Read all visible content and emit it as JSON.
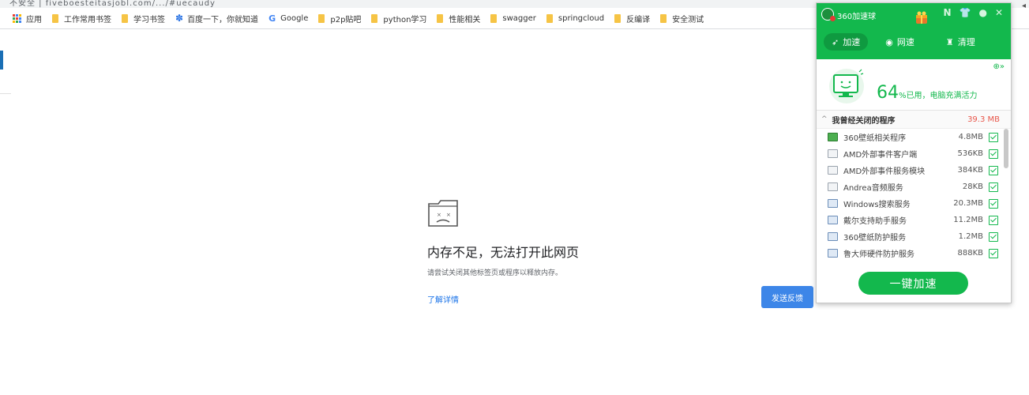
{
  "browser": {
    "address_fragment": "不安全 | fiveboesteitasjobl.com/.../#uecaudy",
    "bookmarks": [
      {
        "label": "应用",
        "icon": "apps-grid-icon"
      },
      {
        "label": "工作常用书签",
        "icon": "folder-icon"
      },
      {
        "label": "学习书签",
        "icon": "folder-icon"
      },
      {
        "label": "百度一下，你就知道",
        "icon": "baidu-paw-icon"
      },
      {
        "label": "Google",
        "icon": "google-g-icon"
      },
      {
        "label": "p2p贴吧",
        "icon": "folder-icon"
      },
      {
        "label": "python学习",
        "icon": "folder-icon"
      },
      {
        "label": "性能相关",
        "icon": "folder-icon"
      },
      {
        "label": "swagger",
        "icon": "folder-icon"
      },
      {
        "label": "springcloud",
        "icon": "folder-icon"
      },
      {
        "label": "反编译",
        "icon": "folder-icon"
      },
      {
        "label": "安全测试",
        "icon": "folder-icon"
      }
    ],
    "colors": {
      "folder": "#f6c445",
      "link": "#1a73e8",
      "button": "#3d86e8"
    }
  },
  "error_page": {
    "icon": "sad-tab-icon",
    "title": "内存不足，无法打开此网页",
    "description": "请尝试关闭其他标签页或程序以释放内存。",
    "learn_more": "了解详情",
    "feedback_button": "发送反馈"
  },
  "accelerator": {
    "title": "360加速球",
    "header_icons": [
      "N",
      "shirt-icon",
      "chat-icon",
      "close-icon"
    ],
    "tabs": [
      {
        "label": "加速",
        "icon": "rocket-icon",
        "active": true
      },
      {
        "label": "网速",
        "icon": "network-icon",
        "active": false
      },
      {
        "label": "清理",
        "icon": "broom-icon",
        "active": false
      }
    ],
    "memory_percent": "64",
    "memory_text": "%已用，电脑充满活力",
    "closed_section": {
      "title": "我曾经关闭的程序",
      "total": "39.3 MB",
      "items": [
        {
          "name": "360壁纸相关程序",
          "size": "4.8MB",
          "icon": "green",
          "checked": true
        },
        {
          "name": "AMD外部事件客户端",
          "size": "536KB",
          "icon": "plain",
          "checked": true
        },
        {
          "name": "AMD外部事件服务模块",
          "size": "384KB",
          "icon": "plain",
          "checked": true
        },
        {
          "name": "Andrea音频服务",
          "size": "28KB",
          "icon": "plain",
          "checked": true
        },
        {
          "name": "Windows搜索服务",
          "size": "20.3MB",
          "icon": "win",
          "checked": true
        },
        {
          "name": "戴尔支持助手服务",
          "size": "11.2MB",
          "icon": "win",
          "checked": true
        },
        {
          "name": "360壁纸防护服务",
          "size": "1.2MB",
          "icon": "win",
          "checked": true
        },
        {
          "name": "鲁大师硬件防护服务",
          "size": "888KB",
          "icon": "win",
          "checked": true
        }
      ]
    },
    "boost_button": "一键加速",
    "colors": {
      "primary": "#13b84d",
      "active_tab": "#0f9a40",
      "size_total": "#e8574b"
    }
  }
}
